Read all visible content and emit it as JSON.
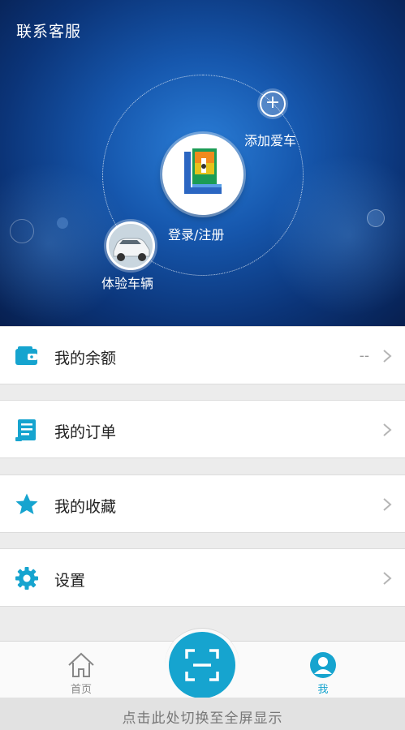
{
  "header": {
    "title": "联系客服",
    "add_car_label": "添加爱车",
    "add_symbol": "+",
    "login_label": "登录/注册",
    "demo_car_label": "体验车辆"
  },
  "menu": [
    {
      "label": "我的余额",
      "value": "--",
      "icon": "wallet-icon"
    },
    {
      "label": "我的订单",
      "value": "",
      "icon": "order-list-icon"
    },
    {
      "label": "我的收藏",
      "value": "",
      "icon": "star-icon"
    },
    {
      "label": "设置",
      "value": "",
      "icon": "gear-icon"
    }
  ],
  "tabbar": {
    "home_label": "首页",
    "me_label": "我",
    "scan_icon": "scan-icon"
  },
  "footer": {
    "text": "点击此处切换至全屏显示"
  },
  "colors": {
    "accent": "#16a4cf",
    "hero_dark": "#071f4f",
    "hero_light": "#2a7dd6"
  }
}
